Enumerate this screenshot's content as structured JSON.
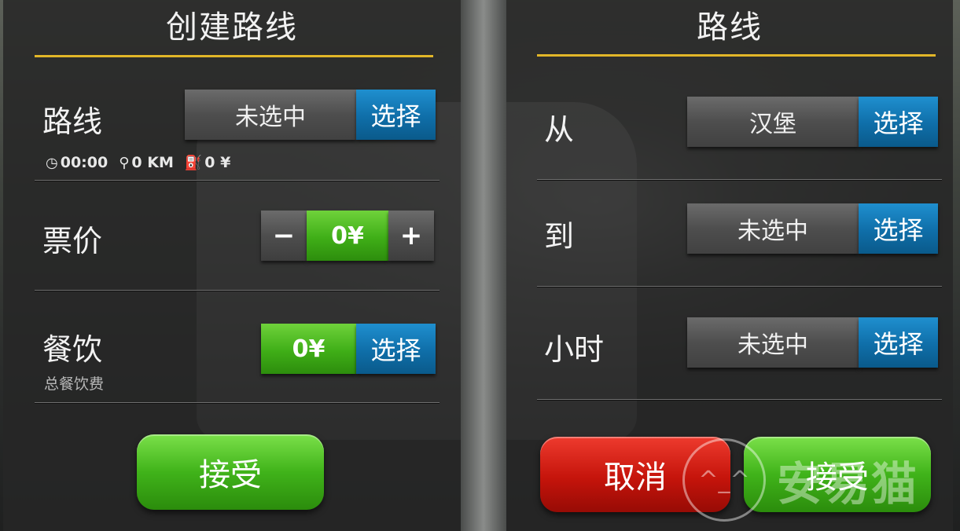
{
  "left_panel": {
    "title": "创建路线",
    "route": {
      "label": "路线",
      "value": "未选中",
      "select": "选择"
    },
    "stats": {
      "time": "00:00",
      "distance": "0 KM",
      "fuel": "0 ¥"
    },
    "fare": {
      "label": "票价",
      "minus": "−",
      "value": "0¥",
      "plus": "+"
    },
    "catering": {
      "label": "餐饮",
      "sublabel": "总餐饮费",
      "value": "0¥",
      "select": "选择"
    },
    "accept": "接受"
  },
  "right_panel": {
    "title": "路线",
    "from": {
      "label": "从",
      "value": "汉堡",
      "select": "选择"
    },
    "to": {
      "label": "到",
      "value": "未选中",
      "select": "选择"
    },
    "hours": {
      "label": "小时",
      "value": "未选中",
      "select": "选择"
    },
    "cancel": "取消",
    "accept": "接受"
  },
  "colors": {
    "accent_gold": "#e2b628",
    "select_blue": "#0f6ea8",
    "value_green": "#3fae17",
    "cancel_red": "#c5140b"
  },
  "watermark": {
    "text": "安易猫"
  }
}
